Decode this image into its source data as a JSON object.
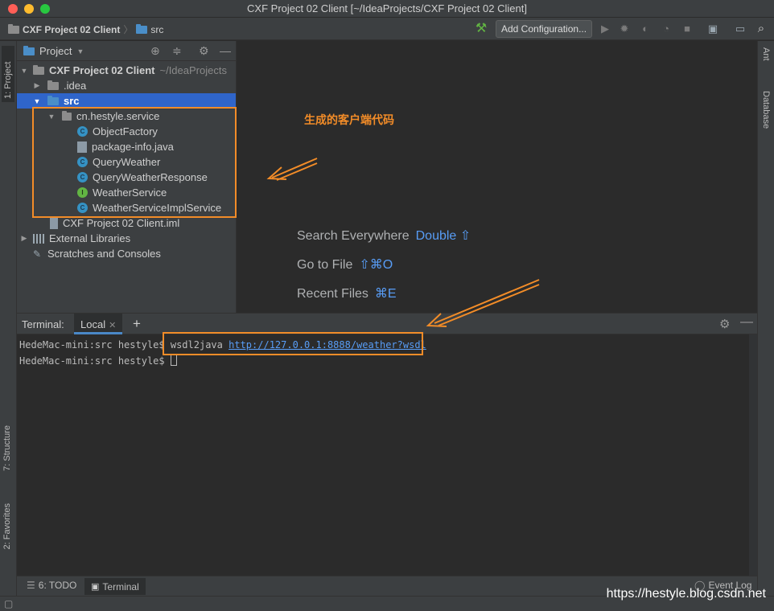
{
  "window": {
    "title": "CXF Project 02 Client [~/IdeaProjects/CXF Project 02 Client]"
  },
  "navbar": {
    "project_crumb": "CXF Project 02 Client",
    "folder_crumb": "src",
    "add_configuration": "Add Configuration..."
  },
  "left_tabs": {
    "project": "1: Project",
    "structure": "7: Structure",
    "favorites": "2: Favorites"
  },
  "right_tabs": {
    "ant": "Ant",
    "database": "Database"
  },
  "project_panel": {
    "title": "Project",
    "root": {
      "name": "CXF Project 02 Client",
      "path": "~/IdeaProjects"
    },
    "items": [
      {
        "label": ".idea"
      },
      {
        "label": "src"
      },
      {
        "label": "cn.hestyle.service"
      },
      {
        "label": "ObjectFactory"
      },
      {
        "label": "package-info.java"
      },
      {
        "label": "QueryWeather"
      },
      {
        "label": "QueryWeatherResponse"
      },
      {
        "label": "WeatherService"
      },
      {
        "label": "WeatherServiceImplService"
      },
      {
        "label": "CXF Project 02 Client.iml"
      },
      {
        "label": "External Libraries"
      },
      {
        "label": "Scratches and Consoles"
      }
    ]
  },
  "editor_hints": {
    "search": {
      "label": "Search Everywhere",
      "key": "Double ⇧"
    },
    "goto": {
      "label": "Go to File",
      "key": "⇧⌘O"
    },
    "recent": {
      "label": "Recent Files",
      "key": "⌘E"
    }
  },
  "annotation": "生成的客户端代码",
  "terminal": {
    "label": "Terminal:",
    "tab": "Local",
    "prompt": "HedeMac-mini:src hestyle$",
    "command": "wsdl2java",
    "url": "http://127.0.0.1:8888/weather?wsdl"
  },
  "bottom_tabs": {
    "todo": "6: TODO",
    "terminal": "Terminal",
    "event_log": "Event Log"
  },
  "watermark": "https://hestyle.blog.csdn.net",
  "colors": {
    "accent": "#2f65ca",
    "annotation": "#f28c28",
    "link": "#589df6"
  }
}
